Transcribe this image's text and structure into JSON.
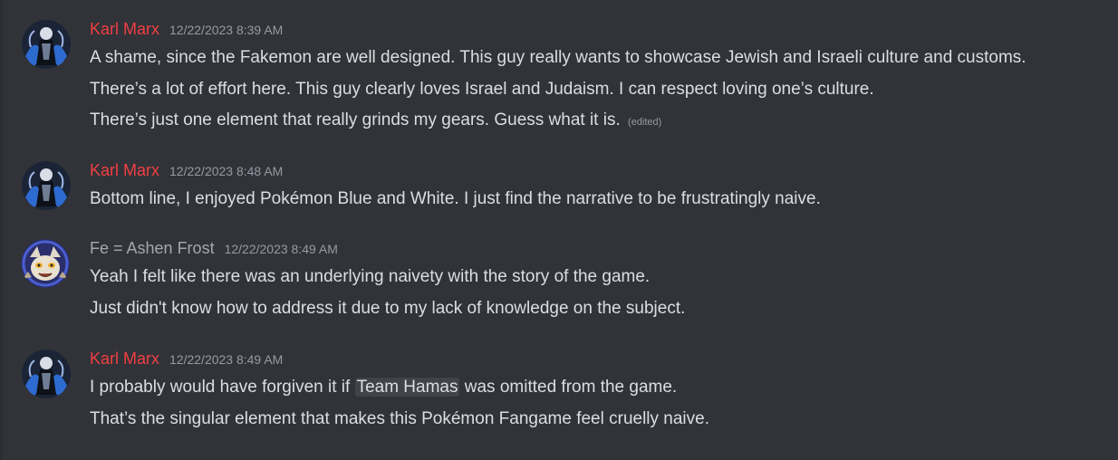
{
  "messages": [
    {
      "author": "Karl Marx",
      "timestamp": "12/22/2023 8:39 AM",
      "lines": [
        "A shame, since the Fakemon are well designed. This guy really wants to showcase Jewish and Israeli culture and customs.",
        "There’s a lot of effort here. This guy clearly loves Israel and Judaism. I can respect loving one’s culture.",
        "There’s just one element that really grinds my gears. Guess what it is."
      ],
      "edited_label": "(edited)"
    },
    {
      "author": "Karl Marx",
      "timestamp": "12/22/2023 8:48 AM",
      "lines": [
        "Bottom line, I enjoyed Pokémon Blue and White. I just find the narrative to be frustratingly naive."
      ]
    },
    {
      "author": "Fe = Ashen Frost",
      "timestamp": "12/22/2023 8:49 AM",
      "lines": [
        "Yeah I felt like there was an underlying naivety with the story of the game.",
        "Just didn't know how to address it due to my lack of knowledge on the subject."
      ]
    },
    {
      "author": "Karl Marx",
      "timestamp": "12/22/2023 8:49 AM",
      "line1_before": "I probably would have forgiven it if ",
      "line1_mention": "Team Hamas",
      "line1_after": " was omitted from the game.",
      "lines": [
        "That’s the singular element that makes this Pokémon Fangame feel cruelly naive."
      ]
    }
  ],
  "colors": {
    "background": "#313338",
    "author_karl": "#f23f43",
    "author_fe": "#a5a7ad",
    "text": "#dbdee1",
    "muted": "#949ba4"
  },
  "icons": {
    "karl_avatar": "dark-figure-avatar-icon",
    "fe_avatar": "cartoon-character-avatar-icon"
  }
}
